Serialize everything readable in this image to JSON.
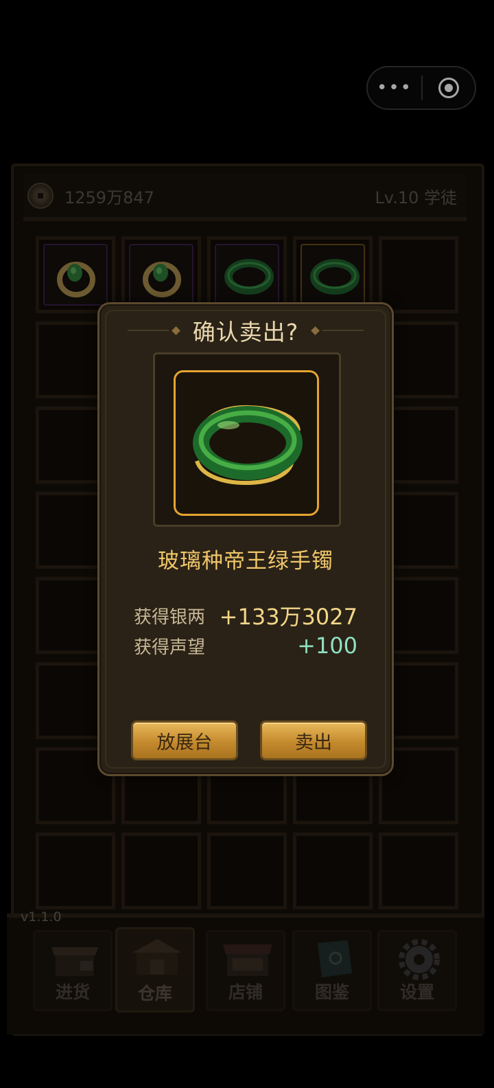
{
  "capsule": {
    "more_label": "•••"
  },
  "status": {
    "silver": "1259万847",
    "level": "Lv.10 学徒"
  },
  "inventory": {
    "items": [
      {
        "name": "ring-icon",
        "rarity_color": "#3b1f45"
      },
      {
        "name": "ring-icon",
        "rarity_color": "#3b1f45"
      },
      {
        "name": "bangle-icon",
        "rarity_color": "#3b1f45"
      },
      {
        "name": "bangle-icon",
        "rarity_color": "#6a4a1a"
      }
    ]
  },
  "modal": {
    "title": "确认卖出?",
    "item_name": "玻璃种帝王绿手镯",
    "silver_label": "获得银两",
    "silver_value": "+133万3027",
    "fame_label": "获得声望",
    "fame_value": "+100",
    "display_button": "放展台",
    "sell_button": "卖出"
  },
  "version": "v1.1.0",
  "nav": [
    {
      "label": "进货",
      "icon": "stall-icon"
    },
    {
      "label": "仓库",
      "icon": "warehouse-icon"
    },
    {
      "label": "店铺",
      "icon": "shop-icon"
    },
    {
      "label": "图鉴",
      "icon": "book-icon"
    },
    {
      "label": "设置",
      "icon": "gear-icon"
    }
  ],
  "colors": {
    "accent_gold": "#e6a432",
    "item_name": "#f0c66a",
    "fame": "#8fe0c2"
  }
}
